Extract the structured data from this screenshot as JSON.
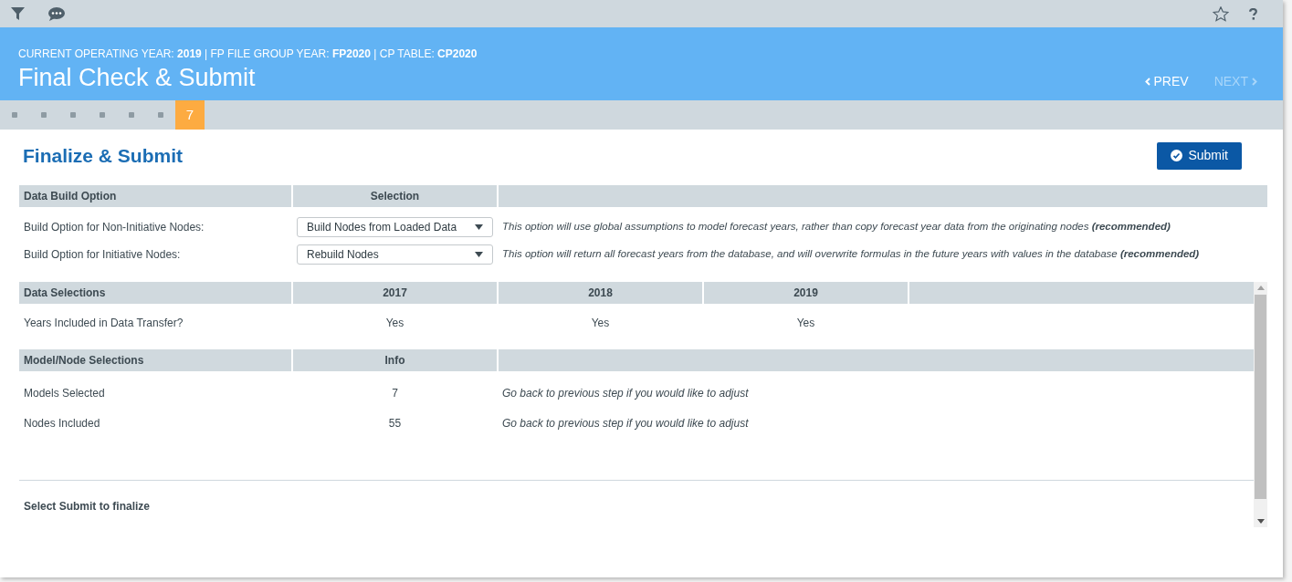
{
  "header": {
    "context": "CURRENT OPERATING YEAR: **2019** | FP FILE GROUP YEAR: **FP2020** | CP TABLE: **CP2020**",
    "title": "Final Check & Submit",
    "prev": {
      "label": "PREV",
      "disabled": false
    },
    "next": {
      "label": "NEXT",
      "disabled": true
    }
  },
  "steps": [
    {
      "selected": false
    },
    {
      "selected": false
    },
    {
      "selected": false
    },
    {
      "selected": false
    },
    {
      "selected": false
    },
    {
      "selected": false
    },
    {
      "label": "7",
      "selected": true
    }
  ],
  "section_title": "Finalize & Submit",
  "submit_button": "Submit",
  "build_table": {
    "columns": [
      "Data Build Option",
      "Selection"
    ],
    "rows": [
      {
        "label": "Build Option for Non-Initiative Nodes:",
        "selection": "Build Nodes from Loaded Data",
        "note": "This option will use global assumptions to model forecast years, rather than copy forecast year data from the originating nodes **(recommended)**"
      },
      {
        "label": "Build Option for Initiative Nodes:",
        "selection": "Rebuild Nodes",
        "note": "This option will return all forecast years from the database, and will overwrite formulas in the future years with values in the database **(recommended)**"
      }
    ]
  },
  "data_table": {
    "columns": [
      "Data Selections",
      "2017",
      "2018",
      "2019"
    ],
    "rows": [
      {
        "label": "Years Included in Data Transfer?",
        "values": [
          "Yes",
          "Yes",
          "Yes"
        ]
      }
    ]
  },
  "model_table": {
    "columns": [
      "Model/Node Selections",
      "Info"
    ],
    "rows": [
      {
        "label": "Models Selected",
        "value": "7",
        "note": "Go back to previous step if you would like to adjust"
      },
      {
        "label": "Nodes Included",
        "value": "55",
        "note": "Go back to previous step if you would like to adjust"
      }
    ]
  },
  "footer": "Select Submit to finalize"
}
